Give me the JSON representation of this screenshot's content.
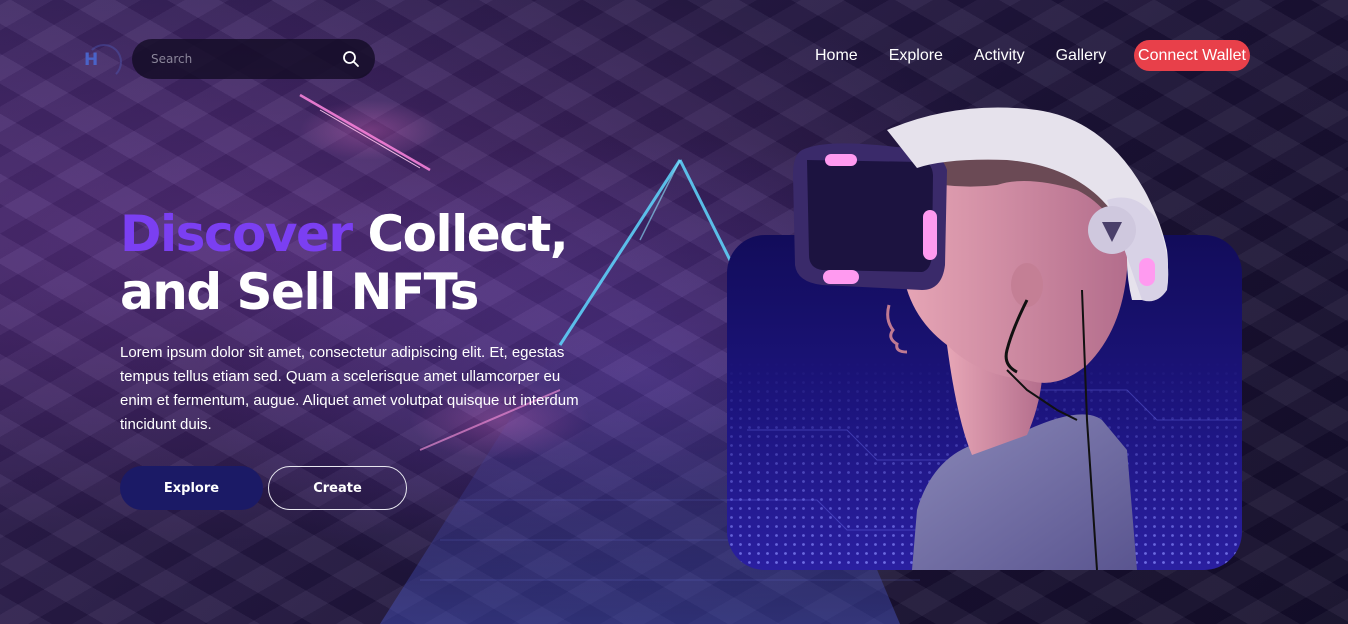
{
  "header": {
    "logo_letter": "H",
    "search": {
      "placeholder": "Search",
      "value": ""
    },
    "nav": [
      {
        "label": "Home"
      },
      {
        "label": "Explore"
      },
      {
        "label": "Activity"
      },
      {
        "label": "Gallery"
      }
    ],
    "connect_label": "Connect Wallet"
  },
  "hero": {
    "title_accent": "Discover",
    "title_rest": " Collect,",
    "title_line2": "and Sell NFTs",
    "description": "Lorem ipsum dolor sit amet, consectetur adipiscing elit. Et, egestas tempus tellus etiam sed. Quam a scelerisque amet ullamcorper eu enim et fermentum, augue. Aliquet amet volutpat quisque ut interdum tincidunt duis.",
    "buttons": {
      "explore": "Explore",
      "create": "Create"
    }
  },
  "icons": {
    "search": "search-icon",
    "logo": "logo-icon",
    "hero_image": "vr-headset-boy-image"
  },
  "colors": {
    "accent": "#7b3ff2",
    "connect_button": "#e8404a",
    "explore_button": "#1b1a66",
    "search_bg": "#140c26"
  }
}
